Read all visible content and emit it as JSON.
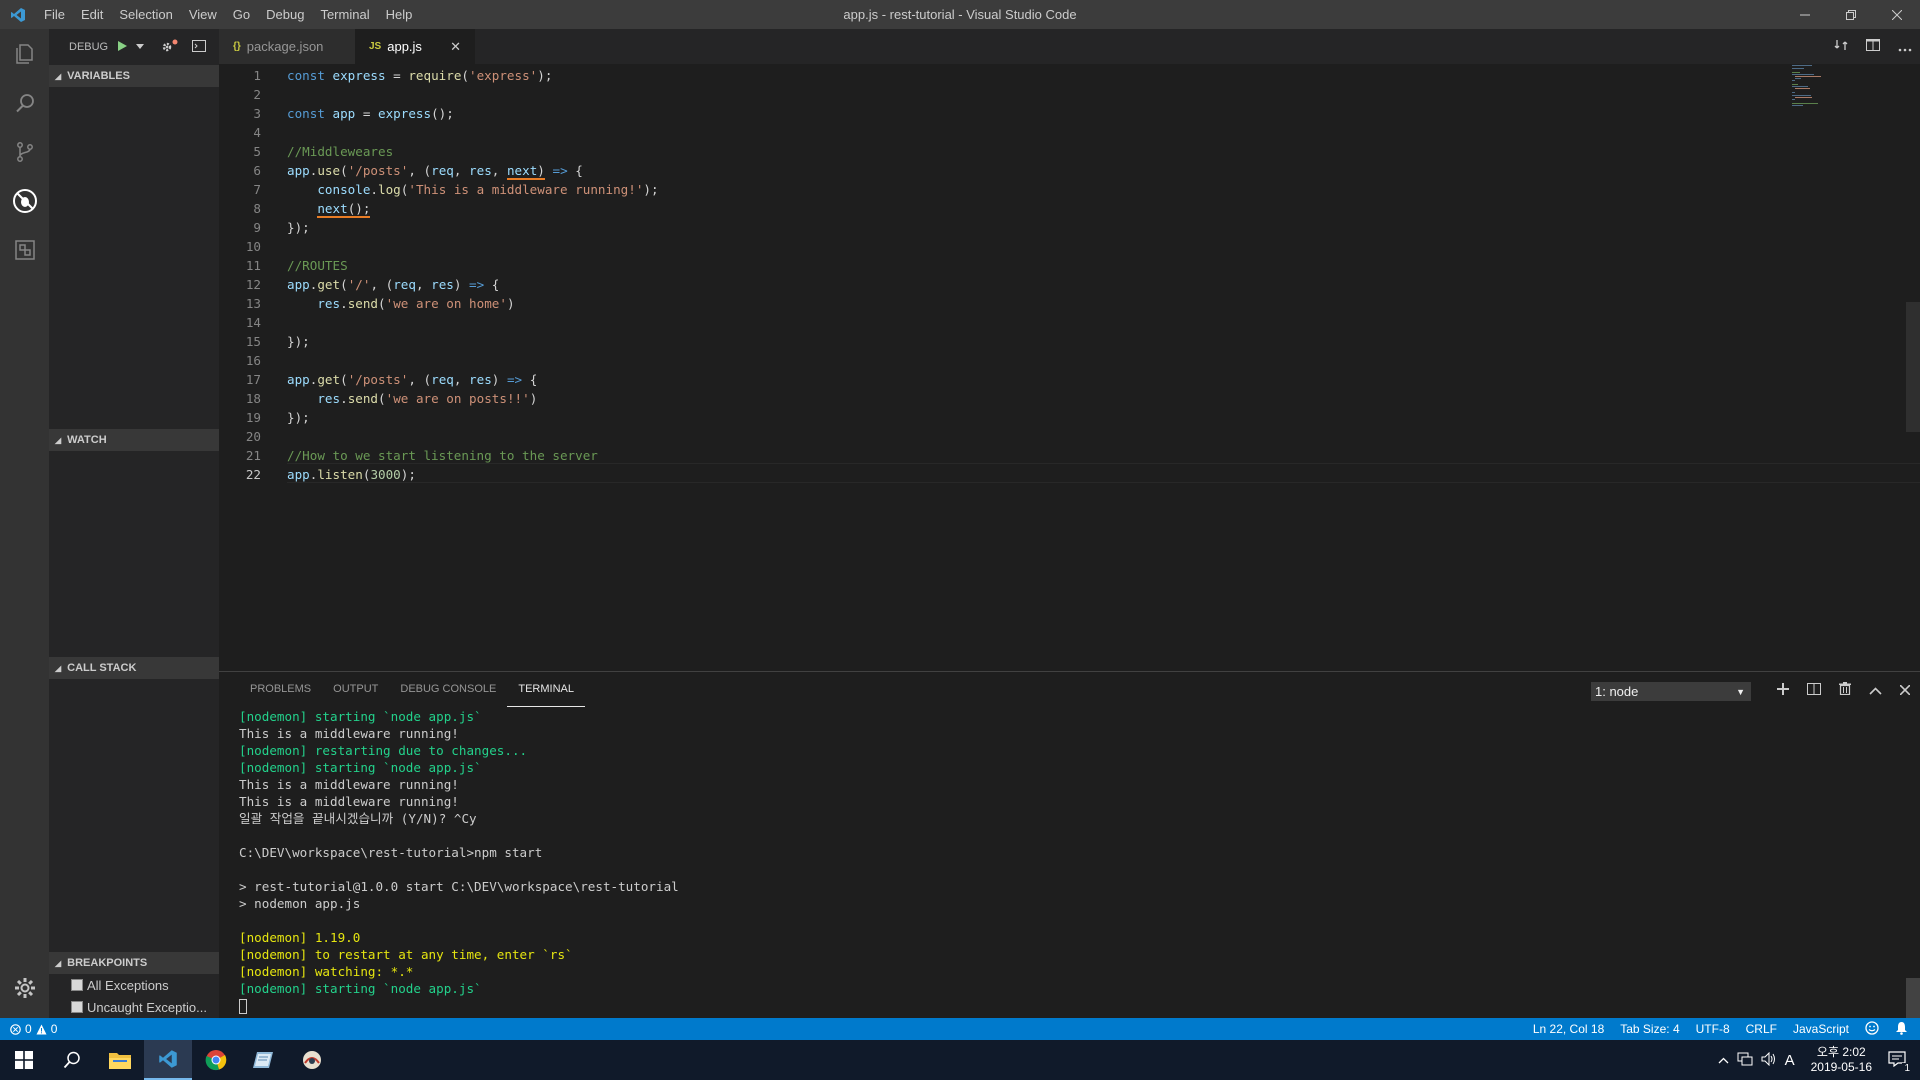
{
  "titlebar": {
    "title": "app.js - rest-tutorial - Visual Studio Code",
    "menu": [
      "File",
      "Edit",
      "Selection",
      "View",
      "Go",
      "Debug",
      "Terminal",
      "Help"
    ]
  },
  "sidebar": {
    "debug_label": "DEBUG",
    "sections": {
      "variables": "VARIABLES",
      "watch": "WATCH",
      "call_stack": "CALL STACK",
      "breakpoints": "BREAKPOINTS"
    },
    "breakpoints": [
      "All Exceptions",
      "Uncaught Exceptio..."
    ]
  },
  "tabs": [
    {
      "label": "package.json",
      "icon": "{}",
      "active": false
    },
    {
      "label": "app.js",
      "icon": "JS",
      "active": true
    }
  ],
  "editor": {
    "current_line": 22,
    "lines": [
      "const express = require('express');",
      "",
      "const app = express();",
      "",
      "//Middleweares",
      "app.use('/posts', (req, res, next) => {",
      "    console.log('This is a middleware running!');",
      "    next();",
      "});",
      "",
      "//ROUTES",
      "app.get('/', (req, res) => {",
      "    res.send('we are on home')",
      "",
      "});",
      "",
      "app.get('/posts', (req, res) => {",
      "    res.send('we are on posts!!')",
      "});",
      "",
      "//How to we start listening to the server",
      "app.listen(3000);"
    ]
  },
  "panel": {
    "tabs": [
      "PROBLEMS",
      "OUTPUT",
      "DEBUG CONSOLE",
      "TERMINAL"
    ],
    "active_tab": "TERMINAL",
    "terminal_select": "1: node",
    "terminal_lines": [
      {
        "text": "[nodemon] starting `node app.js`",
        "color": "green"
      },
      {
        "text": "This is a middleware running!",
        "color": "default"
      },
      {
        "text": "[nodemon] restarting due to changes...",
        "color": "green"
      },
      {
        "text": "[nodemon] starting `node app.js`",
        "color": "green"
      },
      {
        "text": "This is a middleware running!",
        "color": "default"
      },
      {
        "text": "This is a middleware running!",
        "color": "default"
      },
      {
        "text": "일괄 작업을 끝내시겠습니까 (Y/N)? ^Cy",
        "color": "default"
      },
      {
        "text": "",
        "color": "default"
      },
      {
        "text": "C:\\DEV\\workspace\\rest-tutorial>npm start",
        "color": "default"
      },
      {
        "text": "",
        "color": "default"
      },
      {
        "text": "> rest-tutorial@1.0.0 start C:\\DEV\\workspace\\rest-tutorial",
        "color": "default"
      },
      {
        "text": "> nodemon app.js",
        "color": "default"
      },
      {
        "text": "",
        "color": "default"
      },
      {
        "text": "[nodemon] 1.19.0",
        "color": "yellow"
      },
      {
        "text": "[nodemon] to restart at any time, enter `rs`",
        "color": "yellow"
      },
      {
        "text": "[nodemon] watching: *.*",
        "color": "yellow"
      },
      {
        "text": "[nodemon] starting `node app.js`",
        "color": "green"
      }
    ]
  },
  "statusbar": {
    "errors": "0",
    "warnings": "0",
    "position": "Ln 22, Col 18",
    "tab_size": "Tab Size: 4",
    "encoding": "UTF-8",
    "eol": "CRLF",
    "language": "JavaScript"
  },
  "taskbar": {
    "time": "오후 2:02",
    "date": "2019-05-16",
    "ime": "A",
    "notifications": "1"
  },
  "colors": {
    "accent": "#007acc",
    "terminal_green": "#23d18b",
    "terminal_yellow": "#e5e510",
    "squiggle": "#e87c25"
  }
}
